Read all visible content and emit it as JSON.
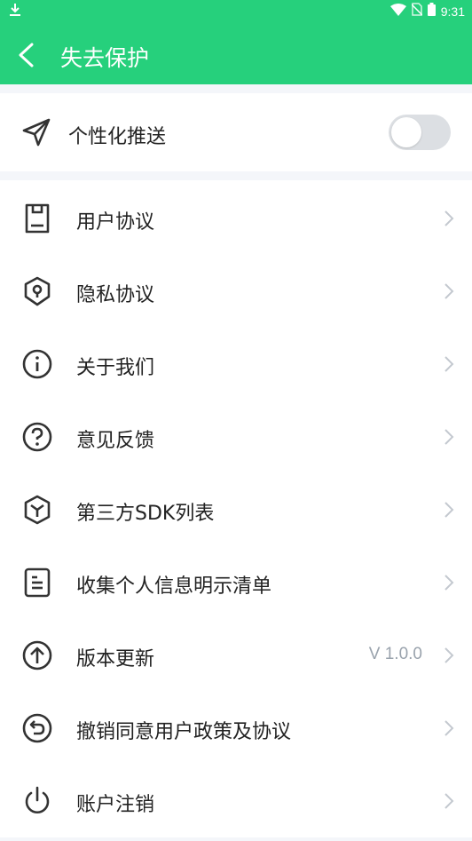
{
  "status_bar": {
    "time": "9:31"
  },
  "app_bar": {
    "title": "失去保护"
  },
  "push": {
    "label": "个性化推送",
    "enabled": false
  },
  "menu": [
    {
      "label": "用户协议",
      "value": ""
    },
    {
      "label": "隐私协议",
      "value": ""
    },
    {
      "label": "关于我们",
      "value": ""
    },
    {
      "label": "意见反馈",
      "value": ""
    },
    {
      "label": "第三方SDK列表",
      "value": ""
    },
    {
      "label": "收集个人信息明示清单",
      "value": ""
    },
    {
      "label": "版本更新",
      "value": "V 1.0.0"
    },
    {
      "label": "撤销同意用户政策及协议",
      "value": ""
    },
    {
      "label": "账户注销",
      "value": ""
    }
  ],
  "colors": {
    "accent": "#26d07c"
  }
}
